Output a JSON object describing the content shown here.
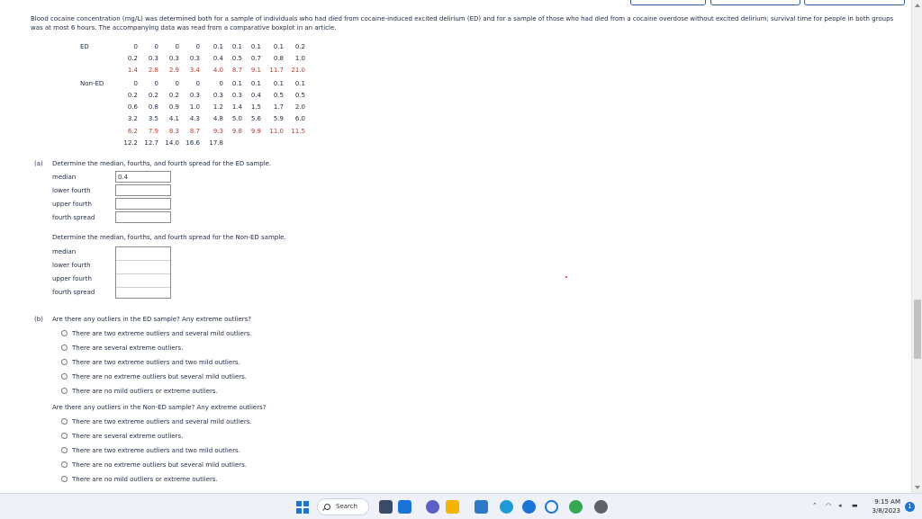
{
  "prompt": "Blood cocaine concentration (mg/L) was determined both for a sample of individuals who had died from cocaine-induced excited delirium (ED) and for a sample of those who had died from a cocaine overdose without excited delirium; survival time for people in both groups was at most 6 hours. The accompanying data was read from a comparative boxplot in an article.",
  "table": {
    "ed_label": "ED",
    "nonED_label": "Non-ED",
    "ed_rows": [
      {
        "values": [
          "0",
          "0",
          "0",
          "0",
          "0.1",
          "0.1",
          "0.1",
          "0.1",
          "0.2"
        ],
        "red": false
      },
      {
        "values": [
          "0.2",
          "0.3",
          "0.3",
          "0.3",
          "0.4",
          "0.5",
          "0.7",
          "0.8",
          "1.0"
        ],
        "red": false
      },
      {
        "values": [
          "1.4",
          "2.8",
          "2.9",
          "3.4",
          "4.0",
          "8.7",
          "9.1",
          "11.7",
          "21.0"
        ],
        "red": true
      }
    ],
    "nonED_rows": [
      {
        "values": [
          "0",
          "0",
          "0",
          "0",
          "0",
          "0.1",
          "0.1",
          "0.1",
          "0.1"
        ],
        "red": false
      },
      {
        "values": [
          "0.2",
          "0.2",
          "0.2",
          "0.3",
          "0.3",
          "0.3",
          "0.4",
          "0.5",
          "0.5"
        ],
        "red": false
      },
      {
        "values": [
          "0.6",
          "0.8",
          "0.9",
          "1.0",
          "1.2",
          "1.4",
          "1.5",
          "1.7",
          "2.0"
        ],
        "red": false
      },
      {
        "values": [
          "3.2",
          "3.5",
          "4.1",
          "4.3",
          "4.8",
          "5.0",
          "5.6",
          "5.9",
          "6.0"
        ],
        "red": false
      },
      {
        "values": [
          "6.2",
          "7.9",
          "8.3",
          "8.7",
          "9.3",
          "9.8",
          "9.9",
          "11.0",
          "11.5"
        ],
        "red": true
      },
      {
        "values": [
          "12.2",
          "12.7",
          "14.0",
          "16.6",
          "17.8"
        ],
        "red": false
      }
    ]
  },
  "part_a": {
    "label": "(a)",
    "ed_question": "Determine the median, fourths, and fourth spread for the ED sample.",
    "nonED_question": "Determine the median, fourths, and fourth spread for the Non-ED sample.",
    "fields": {
      "median": "median",
      "lower_fourth": "lower fourth",
      "upper_fourth": "upper fourth",
      "fourth_spread": "fourth spread"
    },
    "ed_median_value": "0.4"
  },
  "part_b": {
    "label": "(b)",
    "ed_question": "Are there any outliers in the ED sample? Any extreme outliers?",
    "nonED_question": "Are there any outliers in the Non-ED sample? Any extreme outliers?",
    "options": [
      "There are two extreme outliers and several mild outliers.",
      "There are several extreme outliers.",
      "There are two extreme outliers and two mild outliers.",
      "There are no extreme outliers but several mild outliers.",
      "There are no mild outliers or extreme outliers."
    ]
  },
  "taskbar": {
    "search_label": "Search",
    "time": "9:15 AM",
    "date": "3/8/2023",
    "notification_count": "1"
  },
  "colors": {
    "red_row": "#c0392b",
    "accent": "#1a73d9"
  }
}
